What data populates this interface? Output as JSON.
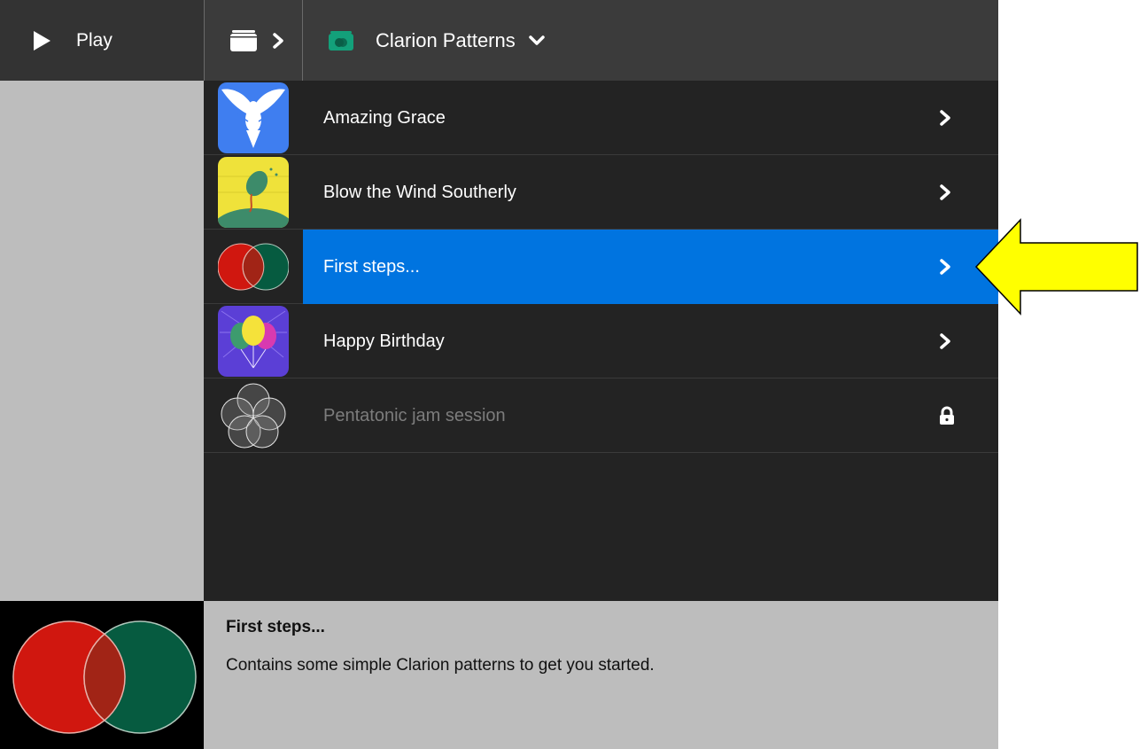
{
  "header": {
    "play_label": "Play",
    "collection_title": "Clarion Patterns"
  },
  "list": {
    "items": [
      {
        "label": "Amazing Grace",
        "thumb": "dove-icon",
        "state": "normal"
      },
      {
        "label": "Blow the Wind Southerly",
        "thumb": "balloon-hill-icon",
        "state": "normal"
      },
      {
        "label": "First steps...",
        "thumb": "venn-red-green-icon",
        "state": "selected"
      },
      {
        "label": "Happy Birthday",
        "thumb": "balloons-icon",
        "state": "normal"
      },
      {
        "label": "Pentatonic jam session",
        "thumb": "circles-icon",
        "state": "locked"
      }
    ]
  },
  "detail": {
    "title": "First steps...",
    "description": "Contains some simple Clarion patterns to get you started."
  },
  "colors": {
    "selection": "#0074e0",
    "list_bg": "#232323",
    "panel_bg": "#bdbdbd",
    "header_bg": "#3b3b3b",
    "pointer": "#ffff00"
  }
}
